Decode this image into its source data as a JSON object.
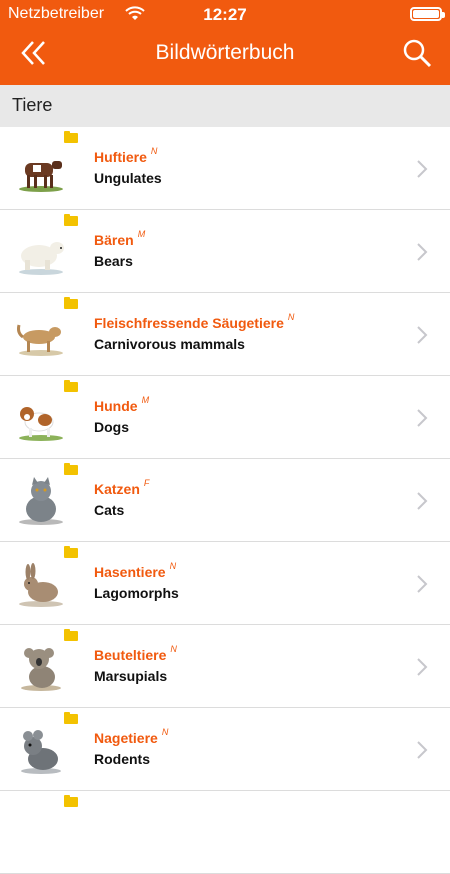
{
  "status": {
    "carrier": "Netzbetreiber",
    "time": "12:27"
  },
  "nav": {
    "title": "Bildwörterbuch",
    "back_icon": "double-chevron-left-icon",
    "search_icon": "search-icon"
  },
  "section": {
    "title": "Tiere"
  },
  "colors": {
    "accent": "#f15a0f",
    "folder": "#f3c200",
    "section_bg": "#e8e8e8"
  },
  "items": [
    {
      "de": "Huftiere",
      "gender": "N",
      "en": "Ungulates",
      "icon": "cow-icon"
    },
    {
      "de": "Bären",
      "gender": "M",
      "en": "Bears",
      "icon": "polar-bear-icon"
    },
    {
      "de": "Fleischfressende Säugetiere",
      "gender": "N",
      "en": "Carnivorous mammals",
      "icon": "cougar-icon"
    },
    {
      "de": "Hunde",
      "gender": "M",
      "en": "Dogs",
      "icon": "dog-icon"
    },
    {
      "de": "Katzen",
      "gender": "F",
      "en": "Cats",
      "icon": "cat-icon"
    },
    {
      "de": "Hasentiere",
      "gender": "N",
      "en": "Lagomorphs",
      "icon": "rabbit-icon"
    },
    {
      "de": "Beuteltiere",
      "gender": "N",
      "en": "Marsupials",
      "icon": "koala-icon"
    },
    {
      "de": "Nagetiere",
      "gender": "N",
      "en": "Rodents",
      "icon": "chinchilla-icon"
    }
  ]
}
